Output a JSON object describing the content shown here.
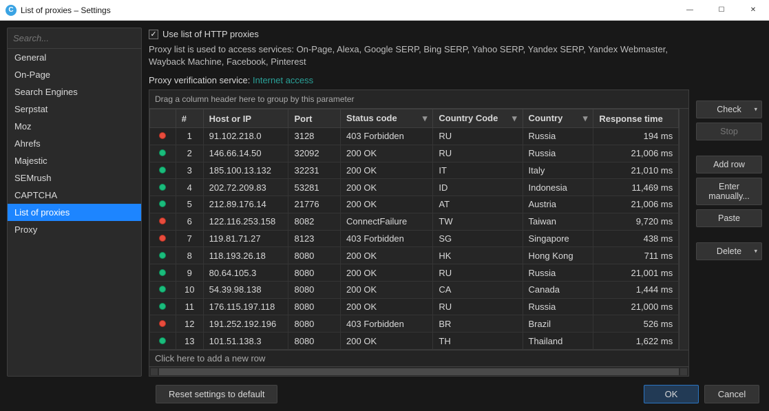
{
  "window": {
    "title": "List of proxies – Settings"
  },
  "sidebar": {
    "search_placeholder": "Search...",
    "items": [
      {
        "label": "General"
      },
      {
        "label": "On-Page"
      },
      {
        "label": "Search Engines"
      },
      {
        "label": "Serpstat"
      },
      {
        "label": "Moz"
      },
      {
        "label": "Ahrefs"
      },
      {
        "label": "Majestic"
      },
      {
        "label": "SEMrush"
      },
      {
        "label": "CAPTCHA"
      },
      {
        "label": "List of proxies"
      },
      {
        "label": "Proxy"
      }
    ],
    "selected_index": 9
  },
  "main": {
    "checkbox_label": "Use list of HTTP proxies",
    "checkbox_checked": true,
    "description": "Proxy list is used to access services: On-Page, Alexa, Google SERP, Bing SERP, Yahoo SERP, Yandex SERP, Yandex Webmaster, Wayback Machine, Facebook, Pinterest",
    "verify_label": "Proxy verification service: ",
    "verify_link": "Internet access",
    "group_hint": "Drag a column header here to group by this parameter",
    "columns": {
      "idx": "#",
      "host": "Host or IP",
      "port": "Port",
      "status": "Status code",
      "cc": "Country Code",
      "country": "Country",
      "rt": "Response time"
    },
    "rows": [
      {
        "ok": false,
        "idx": 1,
        "host": "91.102.218.0",
        "port": "3128",
        "status": "403 Forbidden",
        "cc": "RU",
        "country": "Russia",
        "rt": "194 ms"
      },
      {
        "ok": true,
        "idx": 2,
        "host": "146.66.14.50",
        "port": "32092",
        "status": "200 OK",
        "cc": "RU",
        "country": "Russia",
        "rt": "21,006 ms"
      },
      {
        "ok": true,
        "idx": 3,
        "host": "185.100.13.132",
        "port": "32231",
        "status": "200 OK",
        "cc": "IT",
        "country": "Italy",
        "rt": "21,010 ms"
      },
      {
        "ok": true,
        "idx": 4,
        "host": "202.72.209.83",
        "port": "53281",
        "status": "200 OK",
        "cc": "ID",
        "country": "Indonesia",
        "rt": "11,469 ms"
      },
      {
        "ok": true,
        "idx": 5,
        "host": "212.89.176.14",
        "port": "21776",
        "status": "200 OK",
        "cc": "AT",
        "country": "Austria",
        "rt": "21,006 ms"
      },
      {
        "ok": false,
        "idx": 6,
        "host": "122.116.253.158",
        "port": "8082",
        "status": "ConnectFailure",
        "cc": "TW",
        "country": "Taiwan",
        "rt": "9,720 ms"
      },
      {
        "ok": false,
        "idx": 7,
        "host": "119.81.71.27",
        "port": "8123",
        "status": "403 Forbidden",
        "cc": "SG",
        "country": "Singapore",
        "rt": "438 ms"
      },
      {
        "ok": true,
        "idx": 8,
        "host": "118.193.26.18",
        "port": "8080",
        "status": "200 OK",
        "cc": "HK",
        "country": "Hong Kong",
        "rt": "711 ms"
      },
      {
        "ok": true,
        "idx": 9,
        "host": "80.64.105.3",
        "port": "8080",
        "status": "200 OK",
        "cc": "RU",
        "country": "Russia",
        "rt": "21,001 ms"
      },
      {
        "ok": true,
        "idx": 10,
        "host": "54.39.98.138",
        "port": "8080",
        "status": "200 OK",
        "cc": "CA",
        "country": "Canada",
        "rt": "1,444 ms"
      },
      {
        "ok": true,
        "idx": 11,
        "host": "176.115.197.118",
        "port": "8080",
        "status": "200 OK",
        "cc": "RU",
        "country": "Russia",
        "rt": "21,000 ms"
      },
      {
        "ok": false,
        "idx": 12,
        "host": "191.252.192.196",
        "port": "8080",
        "status": "403 Forbidden",
        "cc": "BR",
        "country": "Brazil",
        "rt": "526 ms"
      },
      {
        "ok": true,
        "idx": 13,
        "host": "101.51.138.3",
        "port": "8080",
        "status": "200 OK",
        "cc": "TH",
        "country": "Thailand",
        "rt": "1,622 ms"
      }
    ],
    "new_row_hint": "Click here to add a new row"
  },
  "buttons": {
    "check": "Check",
    "stop": "Stop",
    "add_row": "Add row",
    "enter_manually": "Enter manually...",
    "paste": "Paste",
    "delete": "Delete"
  },
  "footer": {
    "reset": "Reset settings to default",
    "ok": "OK",
    "cancel": "Cancel"
  }
}
